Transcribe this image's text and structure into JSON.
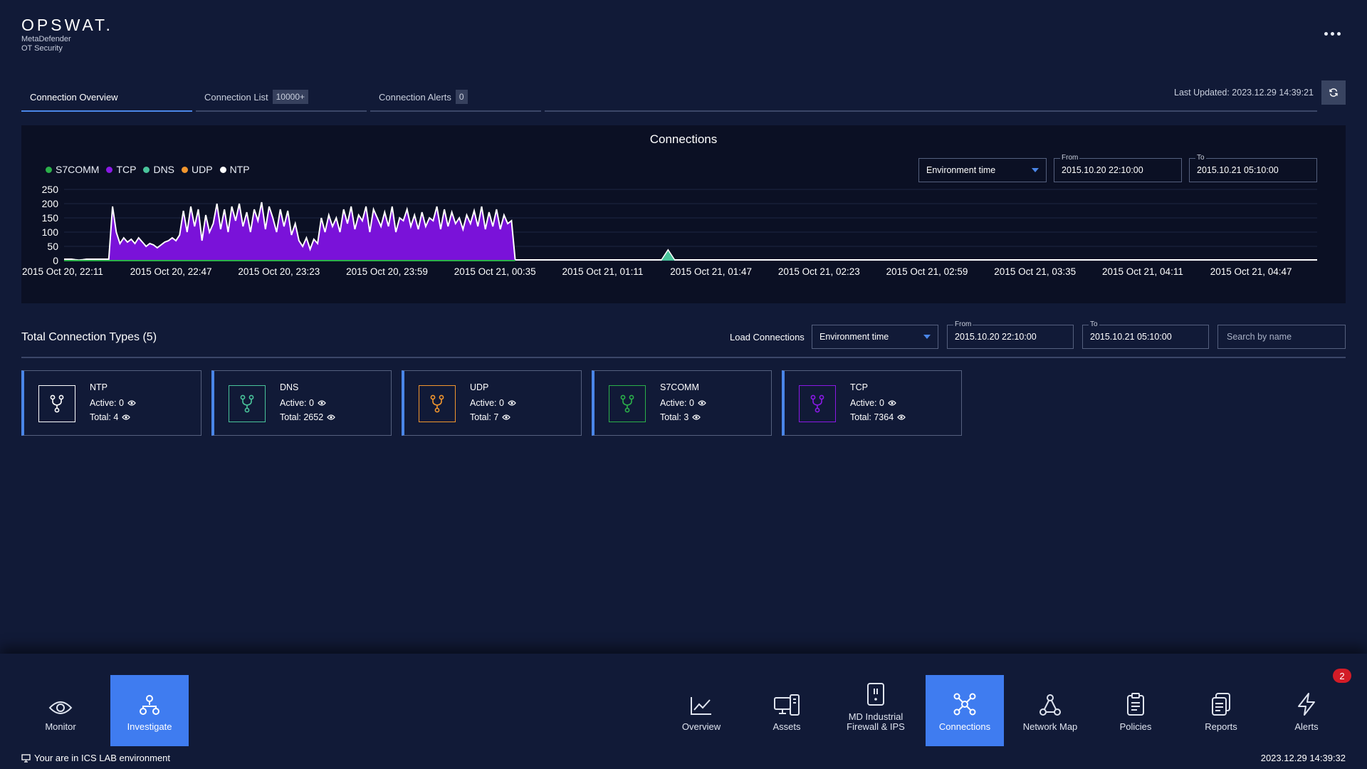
{
  "brand": {
    "logo": "OPSWAT.",
    "product_line1": "MetaDefender",
    "product_line2": "OT Security"
  },
  "tabs": [
    {
      "label": "Connection Overview",
      "badge": null,
      "active": true
    },
    {
      "label": "Connection List",
      "badge": "10000+",
      "active": false
    },
    {
      "label": "Connection Alerts",
      "badge": "0",
      "active": false
    }
  ],
  "last_updated": "Last Updated: 2023.12.29 14:39:21",
  "chart_panel": {
    "title": "Connections",
    "time_mode": "Environment time",
    "from_label": "From",
    "from_value": "2015.10.20 22:10:00",
    "to_label": "To",
    "to_value": "2015.10.21 05:10:00"
  },
  "chart_data": {
    "type": "area",
    "title": "Connections",
    "series": [
      {
        "name": "S7COMM",
        "color": "#2bb04a"
      },
      {
        "name": "TCP",
        "color": "#8a19e6"
      },
      {
        "name": "DNS",
        "color": "#49c49b"
      },
      {
        "name": "UDP",
        "color": "#f2962e"
      },
      {
        "name": "NTP",
        "color": "#ffffff"
      }
    ],
    "yticks": [
      "250",
      "200",
      "150",
      "100",
      "50",
      "0"
    ],
    "ylim": [
      0,
      250
    ],
    "xtick_labels": [
      "2015 Oct 20, 22:11",
      "2015 Oct 20, 22:47",
      "2015 Oct 20, 23:23",
      "2015 Oct 20, 23:59",
      "2015 Oct 21, 00:35",
      "2015 Oct 21, 01:11",
      "2015 Oct 21, 01:47",
      "2015 Oct 21, 02:23",
      "2015 Oct 21, 02:59",
      "2015 Oct 21, 03:35",
      "2015 Oct 21, 04:11",
      "2015 Oct 21, 04:47"
    ],
    "tcp_profile": [
      5,
      5,
      5,
      3,
      2,
      3,
      5,
      5,
      5,
      5,
      5,
      5,
      5,
      190,
      100,
      60,
      80,
      65,
      75,
      60,
      80,
      65,
      50,
      60,
      55,
      45,
      55,
      65,
      70,
      80,
      70,
      90,
      175,
      100,
      190,
      120,
      180,
      70,
      160,
      100,
      130,
      200,
      110,
      180,
      100,
      190,
      140,
      200,
      120,
      170,
      100,
      180,
      140,
      205,
      110,
      190,
      150,
      100,
      180,
      120,
      175,
      90,
      130,
      70,
      50,
      80,
      40,
      75,
      60,
      150,
      100,
      160,
      120,
      150,
      100,
      180,
      130,
      190,
      110,
      160,
      140,
      190,
      100,
      180,
      150,
      120,
      170,
      120,
      190,
      100,
      150,
      140,
      180,
      120,
      160,
      110,
      170,
      120,
      150,
      140,
      190,
      110,
      180,
      120,
      170,
      130,
      150,
      110,
      160,
      130,
      175,
      120,
      190,
      110,
      170,
      120,
      180,
      110,
      160,
      130,
      140,
      3
    ],
    "dns_spike": 38
  },
  "section": {
    "title": "Total Connection Types (5)",
    "load_label": "Load Connections",
    "time_mode": "Environment time",
    "from_label": "From",
    "from_value": "2015.10.20 22:10:00",
    "to_label": "To",
    "to_value": "2015.10.21 05:10:00",
    "search_placeholder": "Search by name"
  },
  "cards": [
    {
      "name": "NTP",
      "active": "Active: 0",
      "total": "Total: 4",
      "color": "#ffffff"
    },
    {
      "name": "DNS",
      "active": "Active: 0",
      "total": "Total: 2652",
      "color": "#49c49b"
    },
    {
      "name": "UDP",
      "active": "Active: 0",
      "total": "Total: 7",
      "color": "#f2962e"
    },
    {
      "name": "S7COMM",
      "active": "Active: 0",
      "total": "Total: 3",
      "color": "#2bb04a"
    },
    {
      "name": "TCP",
      "active": "Active: 0",
      "total": "Total: 7364",
      "color": "#8a19e6"
    }
  ],
  "nav": {
    "monitor": "Monitor",
    "investigate": "Investigate",
    "overview": "Overview",
    "assets": "Assets",
    "firewall_line1": "MD Industrial",
    "firewall_line2": "Firewall & IPS",
    "connections": "Connections",
    "network_map": "Network Map",
    "policies": "Policies",
    "reports": "Reports",
    "alerts": "Alerts",
    "alerts_badge": "2"
  },
  "footer": {
    "environment": "Your are in ICS LAB environment",
    "clock": "2023.12.29 14:39:32"
  }
}
